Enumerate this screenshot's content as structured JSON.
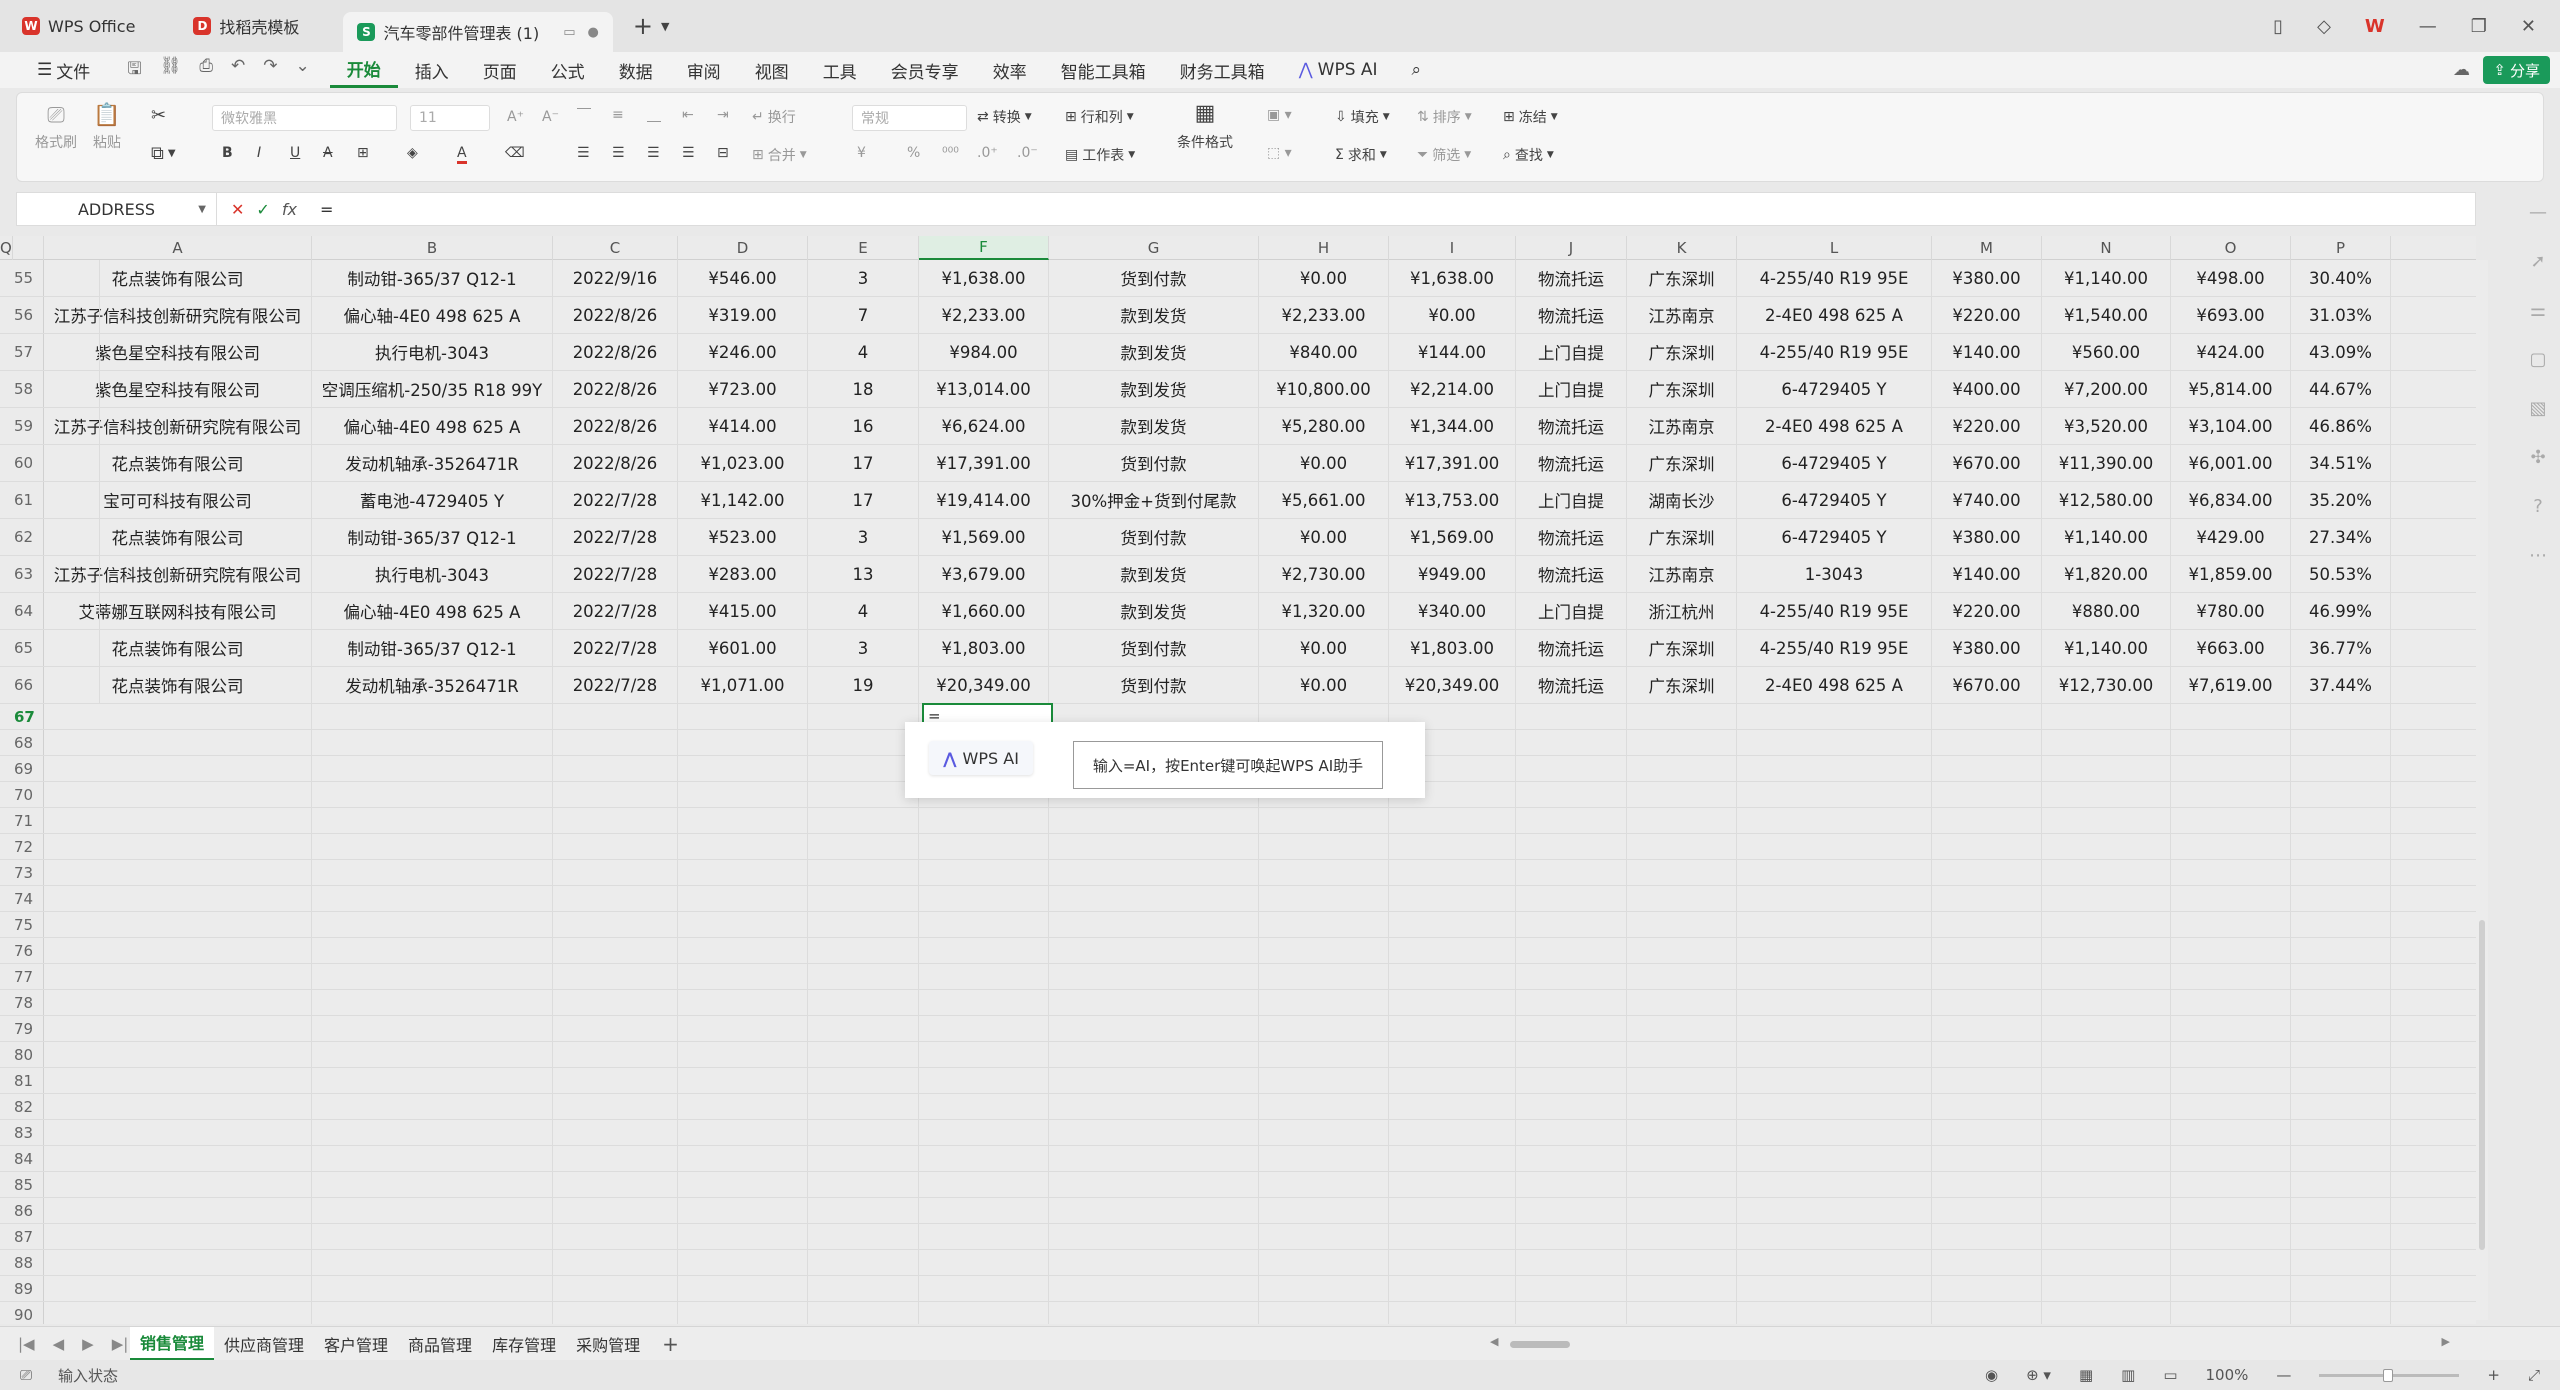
{
  "titlebar": {
    "tabs": [
      {
        "label": "WPS Office",
        "logo": "W",
        "color": "#d9342b"
      },
      {
        "label": "找稻壳模板",
        "logo": "D",
        "color": "#d9342b"
      },
      {
        "label": "汽车零部件管理表 (1)",
        "logo": "S",
        "color": "#1a9a5a"
      }
    ],
    "new_tab_symbol": "+"
  },
  "menubar": {
    "file": "文件",
    "items": [
      "开始",
      "插入",
      "页面",
      "公式",
      "数据",
      "审阅",
      "视图",
      "工具",
      "会员专享",
      "效率",
      "智能工具箱",
      "财务工具箱"
    ],
    "active_index": 0,
    "wps_ai": "WPS AI",
    "share": "分享"
  },
  "ribbon": {
    "format_painter": "格式刷",
    "paste": "粘贴",
    "font_name": "微软雅黑",
    "font_size": "11",
    "wrap": "换行",
    "merge": "合并",
    "number_format": "常规",
    "convert": "转换",
    "row_col": "行和列",
    "worksheet": "工作表",
    "cond_format": "条件格式",
    "fill": "填充",
    "sort": "排序",
    "freeze": "冻结",
    "sum": "求和",
    "filter": "筛选",
    "find": "查找"
  },
  "formula_bar": {
    "name_box": "ADDRESS",
    "fx": "fx",
    "value": "="
  },
  "columns": [
    "A",
    "B",
    "C",
    "D",
    "E",
    "F",
    "G",
    "H",
    "I",
    "J",
    "K",
    "L",
    "M",
    "N",
    "O",
    "P",
    "Q"
  ],
  "selected_column": "F",
  "rows": [
    {
      "n": "55",
      "cells": [
        "花点装饰有限公司",
        "制动钳-365/37 Q12-1",
        "2022/9/16",
        "¥546.00",
        "3",
        "¥1,638.00",
        "货到付款",
        "¥0.00",
        "¥1,638.00",
        "物流托运",
        "广东深圳",
        "4-255/40 R19 95E",
        "¥380.00",
        "¥1,140.00",
        "¥498.00",
        "30.40%"
      ]
    },
    {
      "n": "56",
      "cells": [
        "江苏子信科技创新研究院有限公司",
        "偏心轴-4E0 498 625 A",
        "2022/8/26",
        "¥319.00",
        "7",
        "¥2,233.00",
        "款到发货",
        "¥2,233.00",
        "¥0.00",
        "物流托运",
        "江苏南京",
        "2-4E0 498 625 A",
        "¥220.00",
        "¥1,540.00",
        "¥693.00",
        "31.03%"
      ]
    },
    {
      "n": "57",
      "cells": [
        "紫色星空科技有限公司",
        "执行电机-3043",
        "2022/8/26",
        "¥246.00",
        "4",
        "¥984.00",
        "款到发货",
        "¥840.00",
        "¥144.00",
        "上门自提",
        "广东深圳",
        "4-255/40 R19 95E",
        "¥140.00",
        "¥560.00",
        "¥424.00",
        "43.09%"
      ]
    },
    {
      "n": "58",
      "cells": [
        "紫色星空科技有限公司",
        "空调压缩机-250/35 R18 99Y",
        "2022/8/26",
        "¥723.00",
        "18",
        "¥13,014.00",
        "款到发货",
        "¥10,800.00",
        "¥2,214.00",
        "上门自提",
        "广东深圳",
        "6-4729405 Y",
        "¥400.00",
        "¥7,200.00",
        "¥5,814.00",
        "44.67%"
      ]
    },
    {
      "n": "59",
      "cells": [
        "江苏子信科技创新研究院有限公司",
        "偏心轴-4E0 498 625 A",
        "2022/8/26",
        "¥414.00",
        "16",
        "¥6,624.00",
        "款到发货",
        "¥5,280.00",
        "¥1,344.00",
        "物流托运",
        "江苏南京",
        "2-4E0 498 625 A",
        "¥220.00",
        "¥3,520.00",
        "¥3,104.00",
        "46.86%"
      ]
    },
    {
      "n": "60",
      "cells": [
        "花点装饰有限公司",
        "发动机轴承-3526471R",
        "2022/8/26",
        "¥1,023.00",
        "17",
        "¥17,391.00",
        "货到付款",
        "¥0.00",
        "¥17,391.00",
        "物流托运",
        "广东深圳",
        "6-4729405 Y",
        "¥670.00",
        "¥11,390.00",
        "¥6,001.00",
        "34.51%"
      ]
    },
    {
      "n": "61",
      "cells": [
        "宝可可科技有限公司",
        "蓄电池-4729405 Y",
        "2022/7/28",
        "¥1,142.00",
        "17",
        "¥19,414.00",
        "30%押金+货到付尾款",
        "¥5,661.00",
        "¥13,753.00",
        "上门自提",
        "湖南长沙",
        "6-4729405 Y",
        "¥740.00",
        "¥12,580.00",
        "¥6,834.00",
        "35.20%"
      ]
    },
    {
      "n": "62",
      "cells": [
        "花点装饰有限公司",
        "制动钳-365/37 Q12-1",
        "2022/7/28",
        "¥523.00",
        "3",
        "¥1,569.00",
        "货到付款",
        "¥0.00",
        "¥1,569.00",
        "物流托运",
        "广东深圳",
        "6-4729405 Y",
        "¥380.00",
        "¥1,140.00",
        "¥429.00",
        "27.34%"
      ]
    },
    {
      "n": "63",
      "cells": [
        "江苏子信科技创新研究院有限公司",
        "执行电机-3043",
        "2022/7/28",
        "¥283.00",
        "13",
        "¥3,679.00",
        "款到发货",
        "¥2,730.00",
        "¥949.00",
        "物流托运",
        "江苏南京",
        "1-3043",
        "¥140.00",
        "¥1,820.00",
        "¥1,859.00",
        "50.53%"
      ]
    },
    {
      "n": "64",
      "cells": [
        "艾蒂娜互联网科技有限公司",
        "偏心轴-4E0 498 625 A",
        "2022/7/28",
        "¥415.00",
        "4",
        "¥1,660.00",
        "款到发货",
        "¥1,320.00",
        "¥340.00",
        "上门自提",
        "浙江杭州",
        "4-255/40 R19 95E",
        "¥220.00",
        "¥880.00",
        "¥780.00",
        "46.99%"
      ]
    },
    {
      "n": "65",
      "cells": [
        "花点装饰有限公司",
        "制动钳-365/37 Q12-1",
        "2022/7/28",
        "¥601.00",
        "3",
        "¥1,803.00",
        "货到付款",
        "¥0.00",
        "¥1,803.00",
        "物流托运",
        "广东深圳",
        "4-255/40 R19 95E",
        "¥380.00",
        "¥1,140.00",
        "¥663.00",
        "36.77%"
      ]
    },
    {
      "n": "66",
      "cells": [
        "花点装饰有限公司",
        "发动机轴承-3526471R",
        "2022/7/28",
        "¥1,071.00",
        "19",
        "¥20,349.00",
        "货到付款",
        "¥0.00",
        "¥20,349.00",
        "物流托运",
        "广东深圳",
        "2-4E0 498 625 A",
        "¥670.00",
        "¥12,730.00",
        "¥7,619.00",
        "37.44%"
      ]
    }
  ],
  "empty_rows": [
    "67",
    "68",
    "69",
    "70",
    "71",
    "72",
    "73",
    "74",
    "75",
    "76",
    "77",
    "78",
    "79",
    "80",
    "81",
    "82",
    "83",
    "84",
    "85",
    "86",
    "87",
    "88",
    "89",
    "90"
  ],
  "active_row": "67",
  "active_cell_value": "=",
  "ai_popup": {
    "chip_label": "WPS AI",
    "hint": "输入=AI，按Enter键可唤起WPS AI助手"
  },
  "sheets": [
    "销售管理",
    "供应商管理",
    "客户管理",
    "商品管理",
    "库存管理",
    "采购管理"
  ],
  "active_sheet": 0,
  "status": {
    "mode": "输入状态",
    "zoom": "100%"
  }
}
